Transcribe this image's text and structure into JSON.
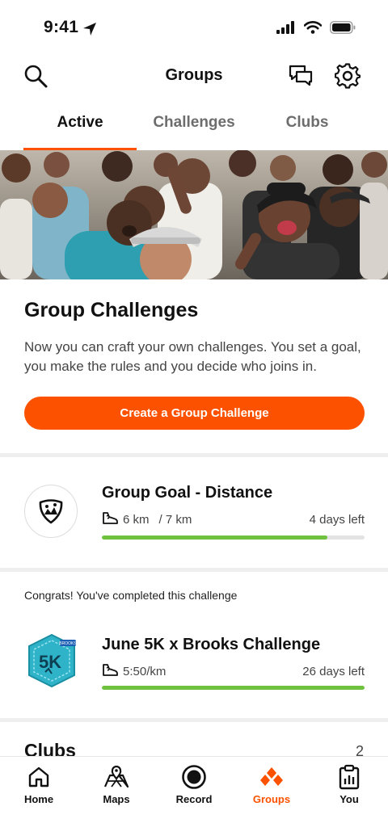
{
  "status_bar": {
    "time": "9:41"
  },
  "header": {
    "title": "Groups",
    "icons": [
      "search-icon",
      "messages-icon",
      "settings-icon"
    ]
  },
  "tabs": [
    {
      "label": "Active",
      "active": true
    },
    {
      "label": "Challenges",
      "active": false
    },
    {
      "label": "Clubs",
      "active": false
    }
  ],
  "intro": {
    "title": "Group Challenges",
    "text": "Now you can craft your own challenges. You set a goal, you make the rules and you decide who joins in.",
    "button_label": "Create a Group Challenge"
  },
  "challenges": [
    {
      "title": "Group Goal - Distance",
      "current": "6 km",
      "goal": "/ 7 km",
      "time_left": "4 days left",
      "progress": 0.857,
      "icon": "group-shield-icon"
    },
    {
      "congrats": "Congrats! You've completed this challenge",
      "title": "June 5K x Brooks Challenge",
      "pace": "5:50/km",
      "time_left": "26 days left",
      "progress": 1.0,
      "badge_text": "5K",
      "badge_brand": "BROOKS",
      "icon": "june-5k-badge-icon"
    }
  ],
  "clubs": {
    "title": "Clubs",
    "count": "2"
  },
  "bottom_nav": [
    {
      "label": "Home",
      "icon": "home-icon",
      "active": false
    },
    {
      "label": "Maps",
      "icon": "maps-icon",
      "active": false
    },
    {
      "label": "Record",
      "icon": "record-icon",
      "active": false
    },
    {
      "label": "Groups",
      "icon": "groups-icon",
      "active": true
    },
    {
      "label": "You",
      "icon": "you-icon",
      "active": false
    }
  ],
  "colors": {
    "accent": "#fc5200",
    "progress": "#6fc23e",
    "badge": "#2fb3c9"
  }
}
